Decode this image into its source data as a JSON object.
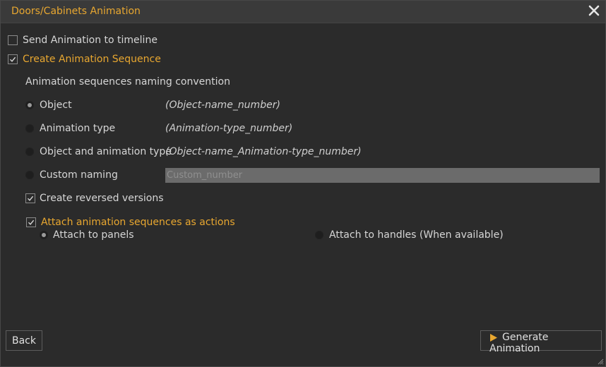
{
  "window": {
    "title": "Doors/Cabinets Animation"
  },
  "options": {
    "send_to_timeline": {
      "label": "Send Animation to timeline",
      "checked": false
    },
    "create_sequence": {
      "label": "Create Animation Sequence",
      "checked": true
    }
  },
  "naming": {
    "heading": "Animation sequences naming convention",
    "choices": [
      {
        "label": "Object",
        "example": "(Object-name_number)",
        "selected": true
      },
      {
        "label": "Animation type",
        "example": "(Animation-type_number)",
        "selected": false
      },
      {
        "label": "Object and animation type",
        "example": "(Object-name_Animation-type_number)",
        "selected": false
      },
      {
        "label": "Custom naming",
        "selected": false
      }
    ],
    "custom_input": {
      "value": "",
      "placeholder": "Custom_number"
    }
  },
  "reversed": {
    "label": "Create reversed versions",
    "checked": true
  },
  "attach": {
    "label": "Attach animation sequences as actions",
    "checked": true,
    "panels_label": "Attach to panels",
    "panels_selected": true,
    "handles_label": "Attach to handles (When available)",
    "handles_selected": false
  },
  "buttons": {
    "back": "Back",
    "generate": "Generate Animation"
  },
  "colors": {
    "accent": "#e8a730",
    "background": "#2b2b2b",
    "titlebar": "#3a3a3a",
    "input_bg": "#6b6b6b"
  }
}
